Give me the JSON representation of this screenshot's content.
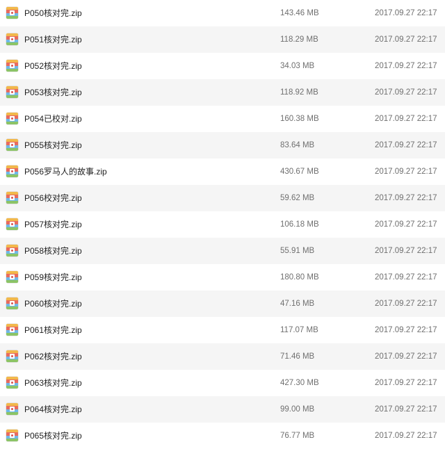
{
  "file_icon": "zip-archive-icon",
  "files": [
    {
      "name": "P050核对完.zip",
      "size": "143.46 MB",
      "date": "2017.09.27 22:17"
    },
    {
      "name": "P051核对完.zip",
      "size": "118.29 MB",
      "date": "2017.09.27 22:17"
    },
    {
      "name": "P052核对完.zip",
      "size": "34.03 MB",
      "date": "2017.09.27 22:17"
    },
    {
      "name": "P053核对完.zip",
      "size": "118.92 MB",
      "date": "2017.09.27 22:17"
    },
    {
      "name": "P054已校对.zip",
      "size": "160.38 MB",
      "date": "2017.09.27 22:17"
    },
    {
      "name": "P055核对完.zip",
      "size": "83.64 MB",
      "date": "2017.09.27 22:17"
    },
    {
      "name": "P056罗马人的故事.zip",
      "size": "430.67 MB",
      "date": "2017.09.27 22:17"
    },
    {
      "name": "P056校对完.zip",
      "size": "59.62 MB",
      "date": "2017.09.27 22:17"
    },
    {
      "name": "P057核对完.zip",
      "size": "106.18 MB",
      "date": "2017.09.27 22:17"
    },
    {
      "name": "P058核对完.zip",
      "size": "55.91 MB",
      "date": "2017.09.27 22:17"
    },
    {
      "name": "P059核对完.zip",
      "size": "180.80 MB",
      "date": "2017.09.27 22:17"
    },
    {
      "name": "P060核对完.zip",
      "size": "47.16 MB",
      "date": "2017.09.27 22:17"
    },
    {
      "name": "P061核对完.zip",
      "size": "117.07 MB",
      "date": "2017.09.27 22:17"
    },
    {
      "name": "P062核对完.zip",
      "size": "71.46 MB",
      "date": "2017.09.27 22:17"
    },
    {
      "name": "P063核对完.zip",
      "size": "427.30 MB",
      "date": "2017.09.27 22:17"
    },
    {
      "name": "P064核对完.zip",
      "size": "99.00 MB",
      "date": "2017.09.27 22:17"
    },
    {
      "name": "P065核对完.zip",
      "size": "76.77 MB",
      "date": "2017.09.27 22:17"
    }
  ]
}
